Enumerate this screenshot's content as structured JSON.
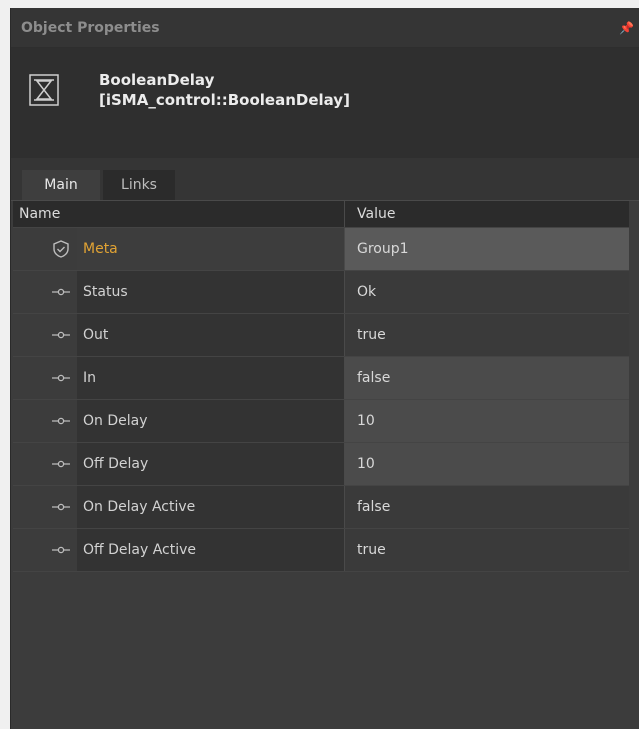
{
  "panel": {
    "title": "Object Properties"
  },
  "object": {
    "name": "BooleanDelay",
    "type": "[iSMA_control::BooleanDelay]"
  },
  "tabs": [
    {
      "label": "Main"
    },
    {
      "label": "Links"
    }
  ],
  "table": {
    "columns": {
      "name": "Name",
      "value": "Value"
    },
    "rows": [
      {
        "name": "Meta",
        "value": "Group1"
      },
      {
        "name": "Status",
        "value": "Ok"
      },
      {
        "name": "Out",
        "value": "true"
      },
      {
        "name": "In",
        "value": "false"
      },
      {
        "name": "On Delay",
        "value": "10"
      },
      {
        "name": "Off Delay",
        "value": "10"
      },
      {
        "name": "On Delay Active",
        "value": "false"
      },
      {
        "name": "Off Delay Active",
        "value": "true"
      }
    ]
  },
  "icons": {
    "object": "hourglass-icon",
    "meta": "shield-icon",
    "slot": "slot-pin-icon",
    "panel_pin": "pin-icon"
  },
  "colors": {
    "meta_accent": "#e1a334",
    "panel_bg": "#3c3c3c"
  }
}
